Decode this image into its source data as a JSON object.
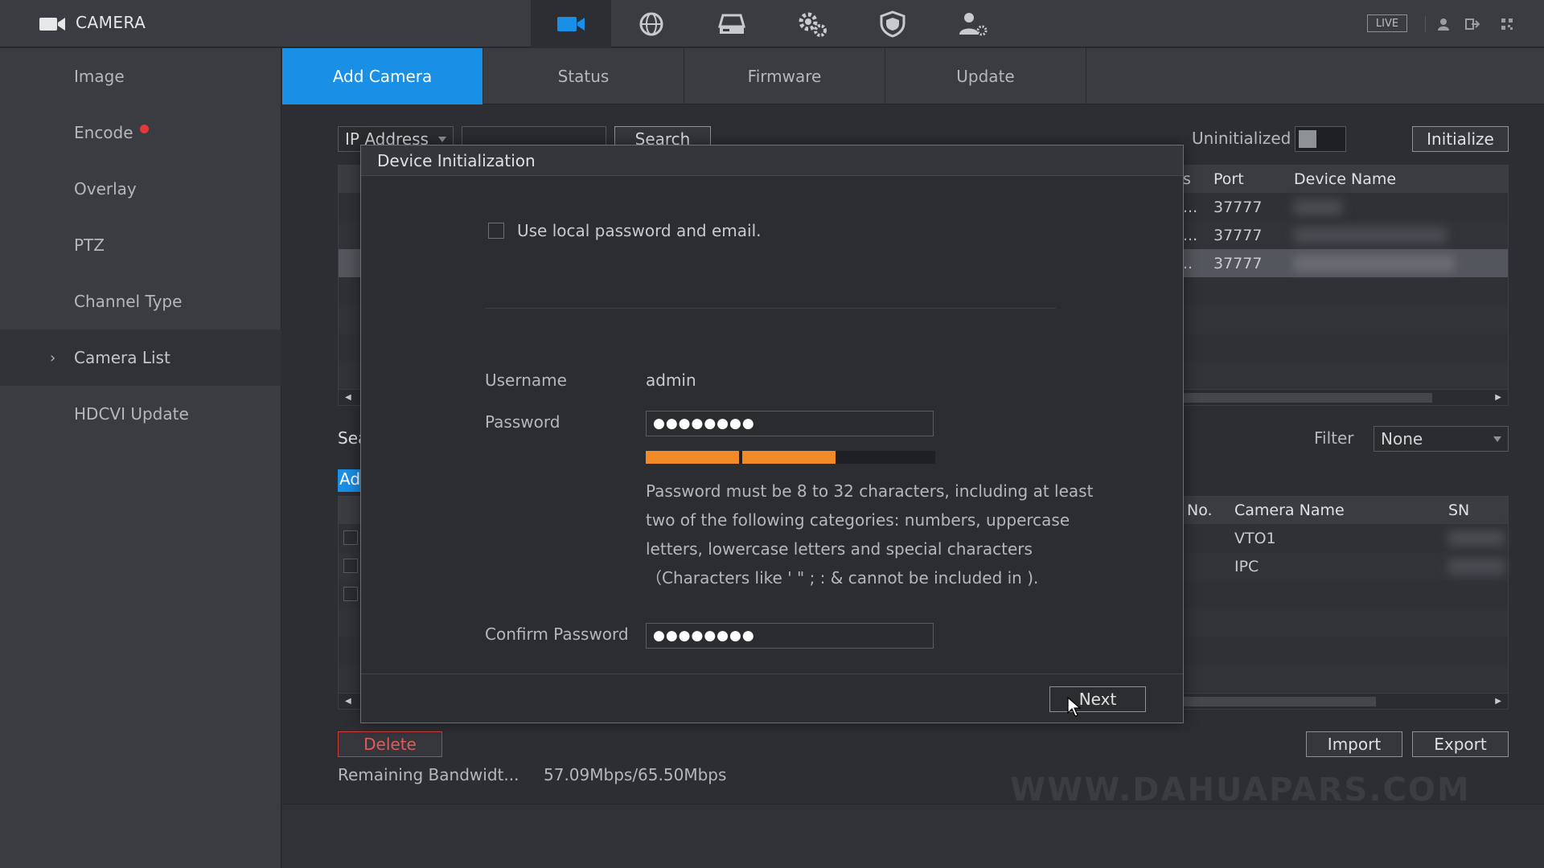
{
  "app": {
    "title": "CAMERA"
  },
  "topnav": {
    "icons": [
      "camera-icon",
      "network-icon",
      "storage-icon",
      "system-settings-icon",
      "security-shield-icon",
      "account-icon"
    ],
    "live_label": "LIVE"
  },
  "sidebar": {
    "items": [
      {
        "label": "Image"
      },
      {
        "label": "Encode"
      },
      {
        "label": "Overlay"
      },
      {
        "label": "PTZ"
      },
      {
        "label": "Channel Type"
      },
      {
        "label": "Camera List"
      },
      {
        "label": "HDCVI Update"
      }
    ],
    "active": "Camera List"
  },
  "tabs": [
    {
      "label": "Add Camera"
    },
    {
      "label": "Status"
    },
    {
      "label": "Firmware"
    },
    {
      "label": "Update"
    }
  ],
  "search": {
    "type_label": "IP Address",
    "button_label": "Search",
    "uninitialized_label": "Uninitialized",
    "initialize_label": "Initialize"
  },
  "top_table": {
    "columns": [
      "s",
      "Port",
      "Device Name"
    ],
    "rows": [
      {
        "status": "...",
        "port": "37777",
        "name": ""
      },
      {
        "status": "...",
        "port": "37777",
        "name": ""
      },
      {
        "status": "..",
        "port": "37777",
        "name": ""
      }
    ]
  },
  "lower": {
    "search_label": "Sea",
    "add_label": "Ad",
    "filter_label": "Filter",
    "filter_value": "None"
  },
  "bottom_table": {
    "columns": [
      "No.",
      "Camera Name",
      "SN"
    ],
    "rows": [
      {
        "camera_name": "VTO1",
        "sn": ""
      },
      {
        "camera_name": "IPC",
        "sn": ""
      }
    ]
  },
  "footer": {
    "delete_label": "Delete",
    "bandwidth_label": "Remaining Bandwidt...",
    "bandwidth_value": "57.09Mbps/65.50Mbps",
    "import_label": "Import",
    "export_label": "Export",
    "watermark": "WWW.DAHUAPARS.COM"
  },
  "modal": {
    "title": "Device Initialization",
    "local_checkbox_label": "Use local password and email.",
    "local_checked": false,
    "username_label": "Username",
    "username_value": "admin",
    "password_label": "Password",
    "password_mask": "●●●●●●●●",
    "password_strength": 0.67,
    "password_hint": "Password must be 8 to 32 characters, including at least two of the following categories: numbers, uppercase letters, lowercase letters and special characters（Characters like ' \" ; : & cannot be included in ).",
    "confirm_label": "Confirm Password",
    "confirm_mask": "●●●●●●●●",
    "next_label": "Next"
  },
  "colors": {
    "accent": "#1a8fe6",
    "strength": "#f28a27",
    "danger": "#d23a3a",
    "badge": "#e03a3a"
  }
}
